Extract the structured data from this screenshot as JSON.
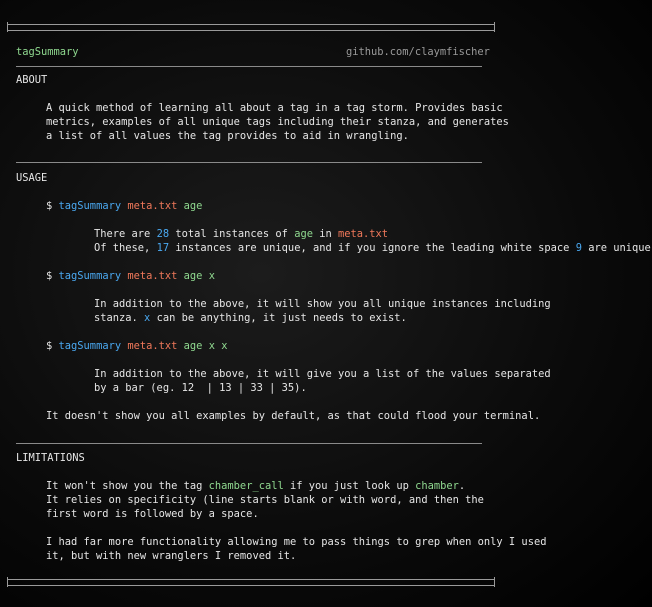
{
  "header": {
    "title": "tagSummary",
    "link": "github.com/claymfischer"
  },
  "about": {
    "heading": "ABOUT",
    "lines": [
      "A quick method of learning all about a tag in a tag storm. Provides basic",
      "metrics, examples of all unique tags including their stanza, and generates",
      "a list of all values the tag provides to aid in wrangling."
    ]
  },
  "usage": {
    "heading": "USAGE",
    "prompt": "$",
    "cmd": "tagSummary",
    "file": "meta.txt",
    "tag": "age",
    "flag": "x",
    "ex1": {
      "l1_a": "There are ",
      "l1_n": "28",
      "l1_b": " total instances of ",
      "l1_tag": "age",
      "l1_c": " in ",
      "l1_file": "meta.txt",
      "l2_a": "Of these, ",
      "l2_n": "17",
      "l2_b": " instances are unique, and if you ignore the leading white space ",
      "l2_n2": "9",
      "l2_c": " are unique."
    },
    "ex2": {
      "l1": "In addition to the above, it will show you all unique instances including",
      "l2_a": "stanza. ",
      "l2_x": "x",
      "l2_b": " can be anything, it just needs to exist."
    },
    "ex3": {
      "l1": "In addition to the above, it will give you a list of the values separated",
      "l2": "by a bar (eg. 12  | 13 | 33 | 35)."
    },
    "footer": "It doesn't show you all examples by default, as that could flood your terminal."
  },
  "limitations": {
    "heading": "LIMITATIONS",
    "l1_a": "It won't show you the tag ",
    "l1_tag1": "chamber_call",
    "l1_b": " if you just look up ",
    "l1_tag2": "chamber",
    "l1_c": ".",
    "l2": "It relies on specificity (line starts blank or with word, and then the",
    "l3": "first word is followed by a space.",
    "l4": "I had far more functionality allowing me to pass things to grep when only I used",
    "l5": "it, but with new wranglers I removed it."
  },
  "colors": {
    "command": "#4aa8f0",
    "file": "#f0785a",
    "tag": "#8fd88f",
    "number": "#4aa8f0",
    "text": "#e6e6e6"
  }
}
